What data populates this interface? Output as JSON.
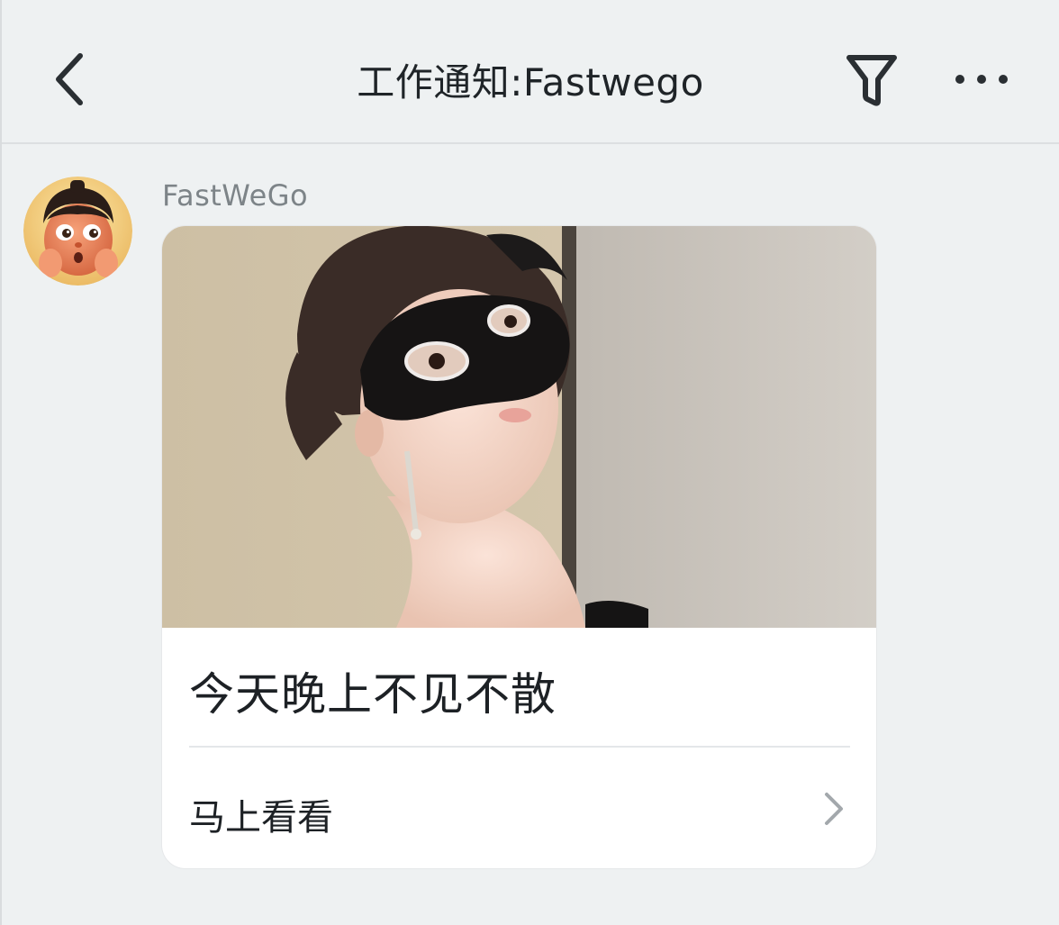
{
  "header": {
    "title": "工作通知:Fastwego",
    "back_icon": "chevron-left-icon",
    "filter_icon": "filter-icon",
    "more_icon": "more-horizontal-icon"
  },
  "message": {
    "sender_name": "FastWeGo",
    "avatar_icon": "cartoon-avatar",
    "card": {
      "title": "今天晚上不见不散",
      "action_label": "马上看看",
      "action_icon": "chevron-right-icon"
    }
  },
  "colors": {
    "background": "#eef1f2",
    "card_background": "#ffffff",
    "text_primary": "#1d2125",
    "text_secondary": "#7d8488"
  }
}
